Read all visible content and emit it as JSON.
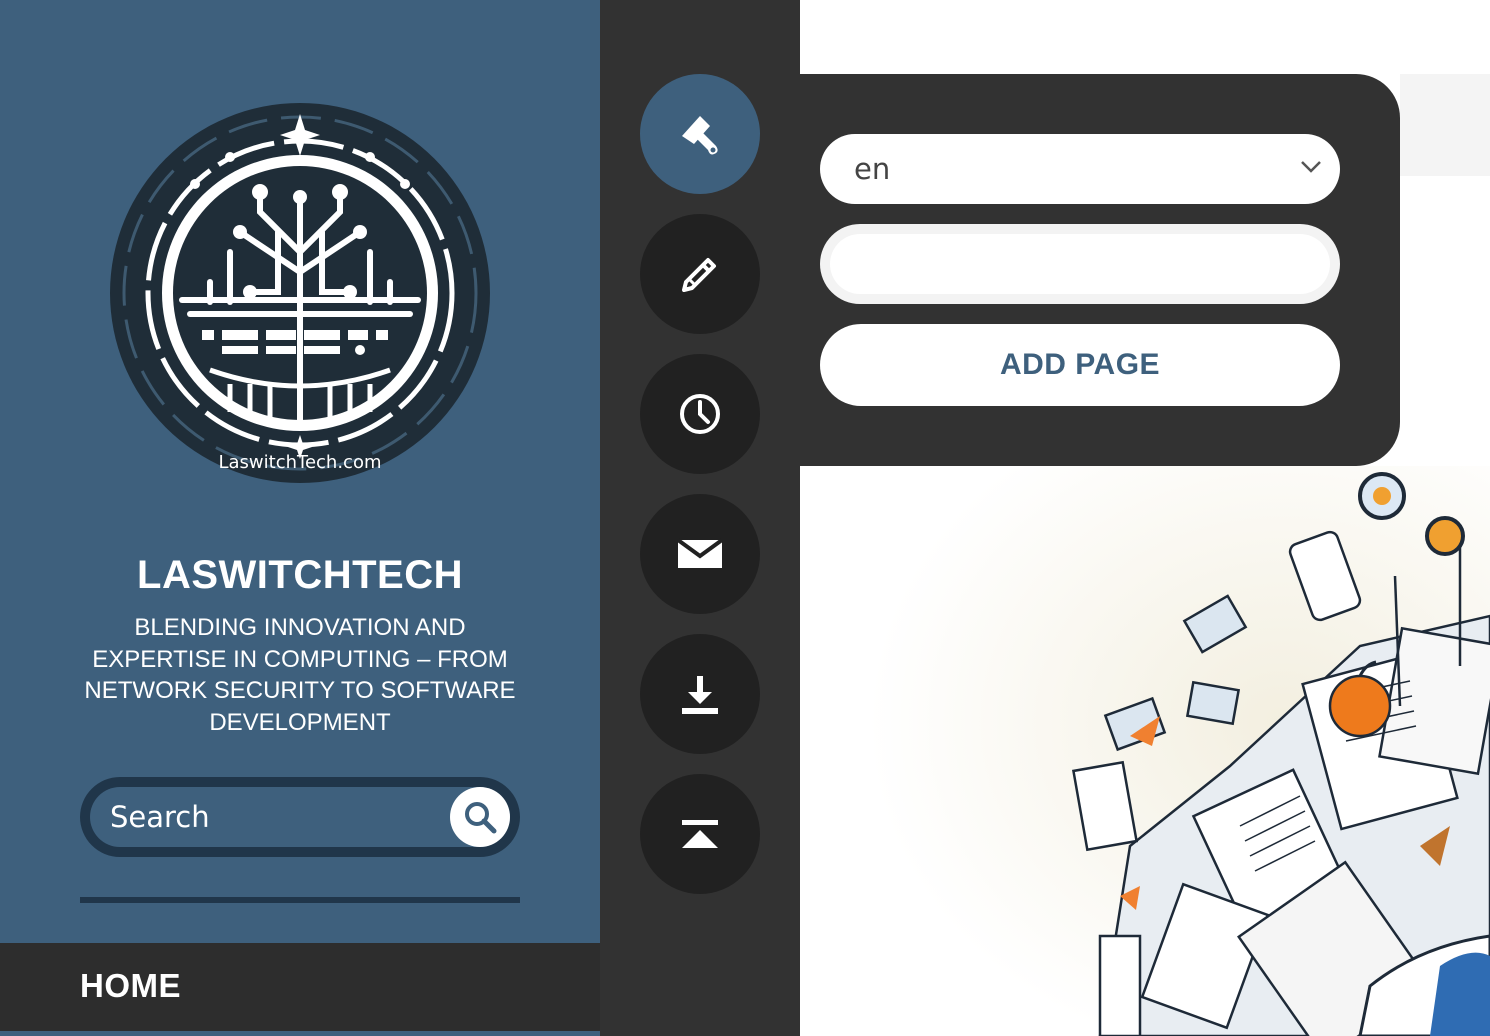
{
  "sidebar": {
    "logo": {
      "alt": "LaswitchTech logo",
      "text": "LaswitchTech.com"
    },
    "title": "LASWITCHTECH",
    "tagline": "BLENDING INNOVATION AND EXPERTISE IN COMPUTING – FROM NETWORK SECURITY TO SOFTWARE DEVELOPMENT",
    "search": {
      "placeholder": "Search",
      "icon": "search-icon"
    }
  },
  "nav": {
    "items": [
      {
        "label": "HOME"
      }
    ]
  },
  "tools": [
    {
      "icon": "paintbrush-icon",
      "active": true
    },
    {
      "icon": "pencil-icon",
      "active": false
    },
    {
      "icon": "clock-icon",
      "active": false
    },
    {
      "icon": "envelope-icon",
      "active": false
    },
    {
      "icon": "download-icon",
      "active": false
    },
    {
      "icon": "scroll-top-icon",
      "active": false
    }
  ],
  "panel": {
    "language": {
      "selected": "en"
    },
    "page_name": {
      "value": ""
    },
    "add_button_label": "ADD PAGE"
  },
  "colors": {
    "brand_blue": "#3e607d",
    "dark_navy": "#20364a",
    "tool_bg": "#323232",
    "tool_btn": "#212121"
  }
}
